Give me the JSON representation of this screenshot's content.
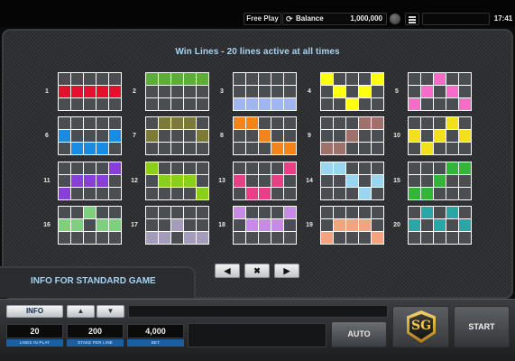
{
  "topbar": {
    "free_play": "Free Play",
    "balance_label": "Balance",
    "balance_value": "1,000,000",
    "clock": "17:41"
  },
  "panel": {
    "title": "Win Lines - 20 lines active at all times"
  },
  "lines": [
    {
      "num": "1",
      "color": "#e3102e",
      "rows": [
        1,
        1,
        1,
        1,
        1
      ]
    },
    {
      "num": "2",
      "color": "#5cad3a",
      "rows": [
        0,
        0,
        0,
        0,
        0
      ]
    },
    {
      "num": "3",
      "color": "#9fb6f0",
      "rows": [
        2,
        2,
        2,
        2,
        2
      ]
    },
    {
      "num": "4",
      "color": "#ffff10",
      "rows": [
        0,
        1,
        2,
        1,
        0
      ]
    },
    {
      "num": "5",
      "color": "#f66cc6",
      "rows": [
        2,
        1,
        0,
        1,
        2
      ]
    },
    {
      "num": "6",
      "color": "#1a8be0",
      "rows": [
        1,
        2,
        2,
        2,
        1
      ]
    },
    {
      "num": "7",
      "color": "#7c7a36",
      "rows": [
        1,
        0,
        0,
        0,
        1
      ]
    },
    {
      "num": "8",
      "color": "#f2841a",
      "rows": [
        0,
        0,
        1,
        2,
        2
      ]
    },
    {
      "num": "9",
      "color": "#a0706a",
      "rows": [
        2,
        2,
        1,
        0,
        0
      ]
    },
    {
      "num": "10",
      "color": "#f2e11a",
      "rows": [
        1,
        2,
        1,
        0,
        1
      ]
    },
    {
      "num": "11",
      "color": "#8a3ed8",
      "rows": [
        2,
        1,
        1,
        1,
        0
      ]
    },
    {
      "num": "12",
      "color": "#8ad018",
      "rows": [
        0,
        1,
        1,
        1,
        2
      ]
    },
    {
      "num": "13",
      "color": "#e93f87",
      "rows": [
        1,
        2,
        2,
        1,
        0
      ]
    },
    {
      "num": "14",
      "color": "#9ad6f0",
      "rows": [
        0,
        0,
        1,
        2,
        1
      ]
    },
    {
      "num": "15",
      "color": "#33b53a",
      "rows": [
        2,
        2,
        1,
        0,
        0
      ]
    },
    {
      "num": "16",
      "color": "#7ed07e",
      "rows": [
        1,
        1,
        0,
        1,
        1
      ]
    },
    {
      "num": "17",
      "color": "#a59cbc",
      "rows": [
        2,
        2,
        1,
        2,
        2
      ]
    },
    {
      "num": "18",
      "color": "#c88ae8",
      "rows": [
        0,
        1,
        1,
        1,
        0
      ]
    },
    {
      "num": "19",
      "color": "#f2a47e",
      "rows": [
        2,
        1,
        1,
        1,
        2
      ]
    },
    {
      "num": "20",
      "color": "#2aa6a6",
      "rows": [
        1,
        0,
        1,
        0,
        1
      ]
    }
  ],
  "nav": {
    "prev": "◀",
    "close": "✖",
    "next": "▶"
  },
  "info_standard": "INFO FOR STANDARD GAME",
  "bottom": {
    "info_label": "INFO",
    "up_arrow": "▲",
    "down_arrow": "▼",
    "lines_value": "20",
    "lines_caption": "LINES IN PLAY",
    "stake_value": "200",
    "stake_caption": "STAKE PER LINE",
    "bet_value": "4,000",
    "bet_caption": "BET",
    "auto_label": "AUTO",
    "logo_text": "SG",
    "start_label": "START"
  }
}
